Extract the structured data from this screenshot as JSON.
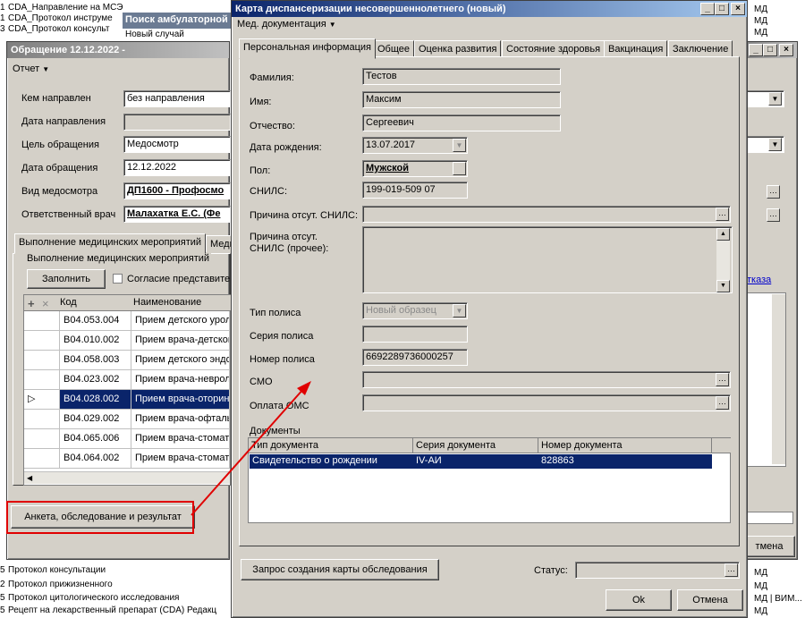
{
  "background": {
    "top_rows": [
      {
        "n": "1",
        "text": "CDA_Направление на МСЭ"
      },
      {
        "n": "1",
        "text": "CDA_Протокол инструме"
      },
      {
        "n": "3",
        "text": "CDA_Протокол консульт"
      }
    ],
    "search_tab": "Поиск амбулаторной",
    "search_tab2": "Новый случай",
    "bottom_rows": [
      {
        "n": "5",
        "text": "Протокол консультации"
      },
      {
        "n": "2",
        "text": "Протокол прижизненного"
      },
      {
        "n": "5",
        "text": "Протокол цитологического исследования"
      },
      {
        "n": "5",
        "text": "Рецепт на лекарственный препарат (CDA) Редакц"
      }
    ],
    "right_col": [
      "МД",
      "МД",
      "МД",
      "МД",
      "МД",
      "МД | ВИМ...",
      "МД"
    ]
  },
  "obr": {
    "title": "Обращение 12.12.2022 -",
    "menu": "Отчет",
    "labels": {
      "kem": "Кем направлен",
      "data_napr": "Дата направления",
      "cel": "Цель обращения",
      "data_obr": "Дата обращения",
      "vid": "Вид медосмотра",
      "vrach": "Ответственный врач"
    },
    "values": {
      "kem": "без направления",
      "data_napr": "",
      "cel": "Медосмотр",
      "data_obr": "12.12.2022",
      "vid": "ДП1600 - Профосмо",
      "vrach": "Малахатка Е.С. (Фе"
    },
    "tab1": "Выполнение медицинских мероприятий",
    "tab2": "Меди",
    "group": "Выполнение медицинских мероприятий",
    "fill_btn": "Заполнить",
    "consent": "Согласие представите",
    "col_code": "Код",
    "col_name": "Наименование",
    "rows": [
      {
        "code": "B04.053.004",
        "name": "Прием детского уроло"
      },
      {
        "code": "B04.010.002",
        "name": "Прием врача-детского"
      },
      {
        "code": "B04.058.003",
        "name": "Прием детского эндо"
      },
      {
        "code": "B04.023.002",
        "name": "Прием врача-невроло"
      },
      {
        "code": "B04.028.002",
        "name": "Прием врача-оторино"
      },
      {
        "code": "B04.029.002",
        "name": "Прием врача-офтальм"
      },
      {
        "code": "B04.065.006",
        "name": "Прием врача-стомато"
      },
      {
        "code": "B04.064.002",
        "name": "Прием врача-стомато"
      }
    ],
    "bottom_btn": "Анкета, обследование и результат",
    "right_link": "тказа",
    "right_btn": "тмена"
  },
  "dlg": {
    "title": "Карта диспансеризации несовершеннолетнего (новый)",
    "menu": "Мед. документация",
    "tabs": [
      "Персональная информация",
      "Общее",
      "Оценка развития",
      "Состояние здоровья",
      "Вакцинация",
      "Заключение"
    ],
    "labels": {
      "surname": "Фамилия:",
      "name": "Имя:",
      "patronymic": "Отчество:",
      "birth": "Дата рождения:",
      "sex": "Пол:",
      "snils": "СНИЛС:",
      "snils_reason": "Причина отсут. СНИЛС:",
      "snils_other": "Причина отсут. СНИЛС (прочее):",
      "policy_type": "Тип полиса",
      "policy_series": "Серия полиса",
      "policy_num": "Номер полиса",
      "smo": "СМО",
      "oms": "Оплата ОМС",
      "docs": "Документы",
      "status": "Статус:"
    },
    "values": {
      "surname": "Тестов",
      "name": "Максим",
      "patronymic": "Сергеевич",
      "birth": "13.07.2017",
      "sex": "Мужской",
      "snils": "199-019-509 07",
      "policy_type": "Новый образец",
      "policy_num": "6692289736000257"
    },
    "doc_cols": [
      "Тип документа",
      "Серия документа",
      "Номер документа"
    ],
    "doc_rows": [
      {
        "type": "Свидетельство о рождении",
        "series": "IV-АИ",
        "number": "828863"
      }
    ],
    "request_btn": "Запрос создания карты обследования",
    "ok": "Ok",
    "cancel": "Отмена"
  }
}
